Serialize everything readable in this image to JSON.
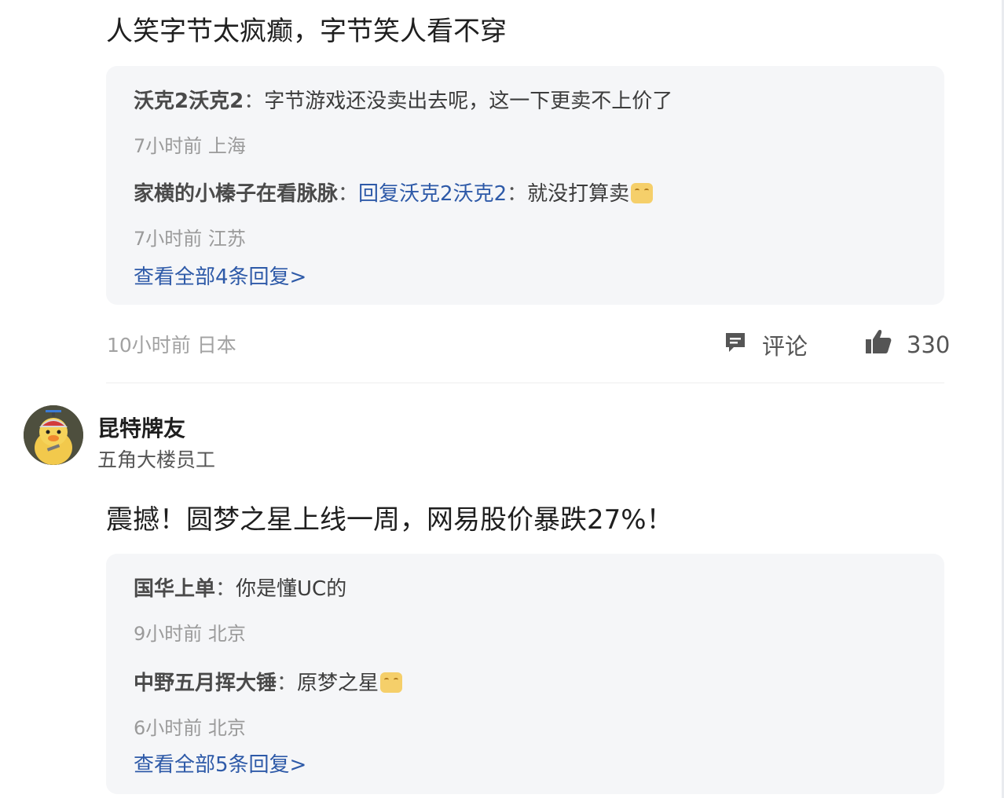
{
  "post1": {
    "text": "人笑字节太疯癫，字节笑人看不穿",
    "replies": [
      {
        "user": "沃克2沃克2",
        "sep": "：",
        "text": "字节游戏还没卖出去呢，这一下更卖不上价了",
        "meta": "7小时前 上海"
      },
      {
        "user": "家横的小榛子在看脉脉",
        "sep": "：",
        "reply_prefix": "回复沃克2沃克2",
        "reply_sep": "：",
        "text": "就没打算卖",
        "emoji": "grin-emoji",
        "meta": "7小时前 江苏"
      }
    ],
    "view_all": "查看全部4条回复>",
    "meta": "10小时前 日本",
    "comment_label": "评论",
    "like_count": "330"
  },
  "post2": {
    "author": {
      "name": "昆特牌友",
      "title": "五角大楼员工",
      "avatar": "duck-avatar"
    },
    "text": "震撼！圆梦之星上线一周，网易股价暴跌27%！",
    "replies": [
      {
        "user": "国华上单",
        "sep": "：",
        "text": "你是懂UC的",
        "meta": "9小时前 北京"
      },
      {
        "user": "中野五月挥大锤",
        "sep": "：",
        "text": "原梦之星",
        "emoji": "grin-emoji",
        "meta": "6小时前 北京"
      }
    ],
    "view_all": "查看全部5条回复>"
  },
  "icons": {
    "comment": "comment-icon",
    "like": "thumbs-up-icon"
  },
  "colors": {
    "link": "#2e5aa8",
    "meta": "#9a9a9a",
    "reply_bg": "#f5f6f8"
  }
}
